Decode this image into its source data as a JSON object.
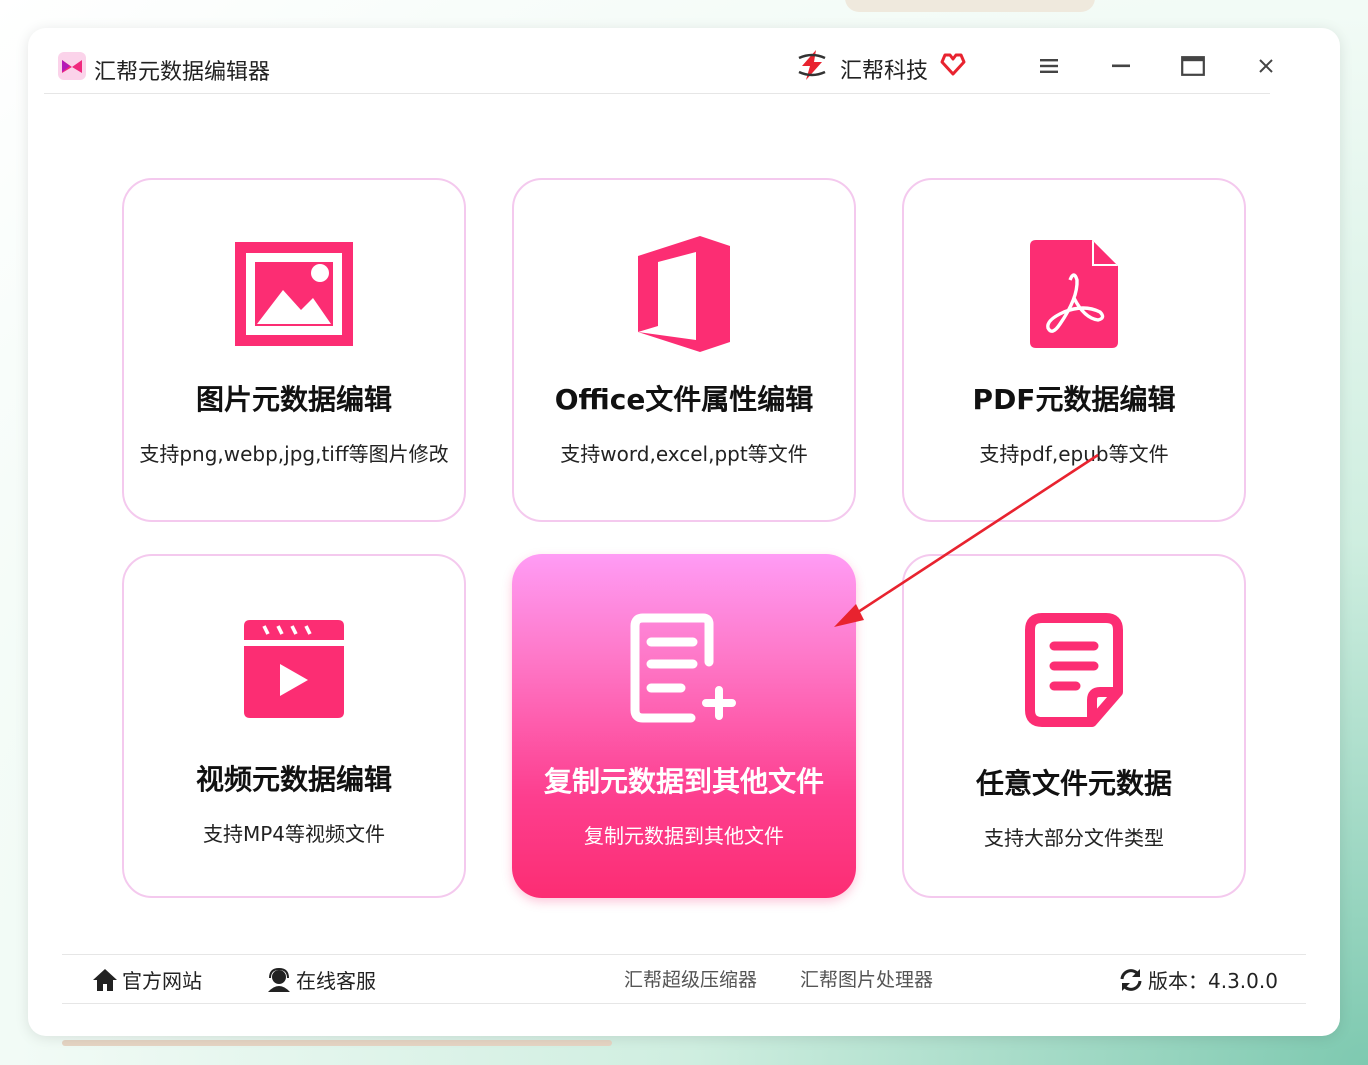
{
  "app": {
    "title": "汇帮元数据编辑器"
  },
  "brand": {
    "name": "汇帮科技"
  },
  "colors": {
    "accent": "#fc2d73",
    "card_border": "#f4c9ee",
    "active_top": "#ff9cf5"
  },
  "cards": [
    {
      "title": "图片元数据编辑",
      "subtitle": "支持png,webp,jpg,tiff等图片修改",
      "icon": "image-icon"
    },
    {
      "title": "Office文件属性编辑",
      "subtitle": "支持word,excel,ppt等文件",
      "icon": "office-icon"
    },
    {
      "title": "PDF元数据编辑",
      "subtitle": "支持pdf,epub等文件",
      "icon": "pdf-icon"
    },
    {
      "title": "视频元数据编辑",
      "subtitle": "支持MP4等视频文件",
      "icon": "video-icon"
    },
    {
      "title": "复制元数据到其他文件",
      "subtitle": "复制元数据到其他文件",
      "icon": "copy-doc-icon",
      "active": true
    },
    {
      "title": "任意文件元数据",
      "subtitle": "支持大部分文件类型",
      "icon": "file-note-icon"
    }
  ],
  "footer": {
    "website": "官方网站",
    "support": "在线客服",
    "link1": "汇帮超级压缩器",
    "link2": "汇帮图片处理器",
    "version": "版本：4.3.0.0"
  }
}
